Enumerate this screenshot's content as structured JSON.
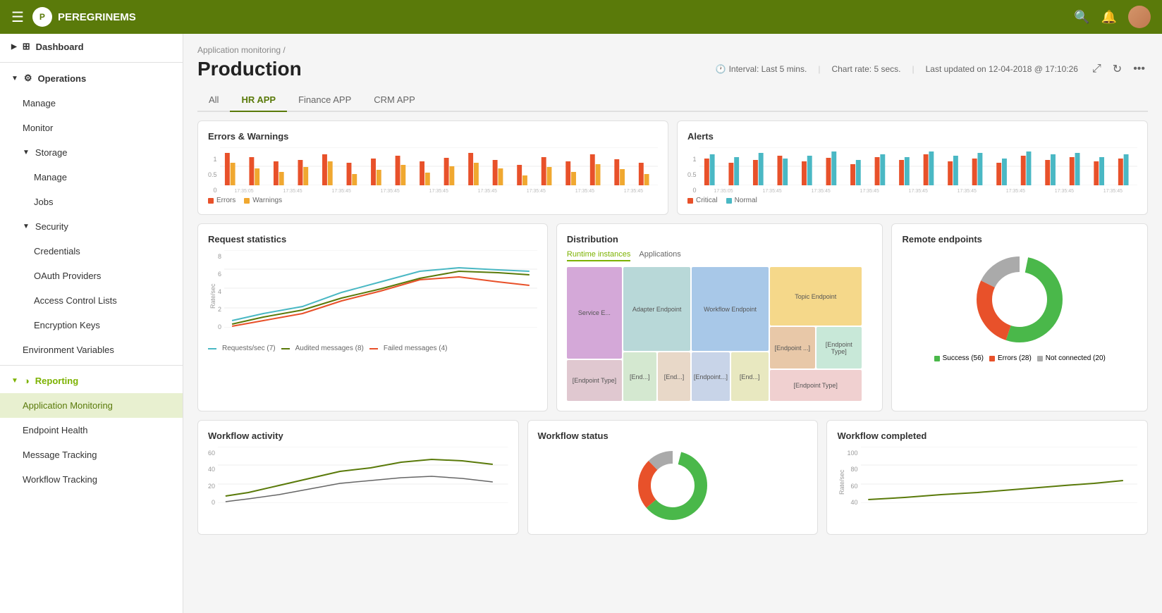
{
  "topnav": {
    "logo_text": "PEREGRINEMS",
    "search_label": "search",
    "bell_label": "notifications",
    "avatar_label": "user avatar"
  },
  "sidebar": {
    "dashboard_label": "Dashboard",
    "operations": {
      "label": "Operations",
      "expanded": true,
      "children": [
        {
          "label": "Manage",
          "level": 1
        },
        {
          "label": "Monitor",
          "level": 1
        },
        {
          "label": "Storage",
          "expanded": true,
          "children": [
            {
              "label": "Manage",
              "level": 2
            },
            {
              "label": "Jobs",
              "level": 2
            }
          ]
        },
        {
          "label": "Security",
          "expanded": true,
          "children": [
            {
              "label": "Credentials",
              "level": 2
            },
            {
              "label": "OAuth Providers",
              "level": 2
            },
            {
              "label": "Access Control Lists",
              "level": 2
            },
            {
              "label": "Encryption Keys",
              "level": 2
            }
          ]
        },
        {
          "label": "Environment Variables",
          "level": 1
        }
      ]
    },
    "reporting": {
      "label": "Reporting",
      "expanded": true,
      "active": true,
      "children": [
        {
          "label": "Application Monitoring",
          "active": true
        },
        {
          "label": "Endpoint Health"
        },
        {
          "label": "Message Tracking"
        },
        {
          "label": "Workflow Tracking"
        }
      ]
    }
  },
  "page": {
    "breadcrumb": "Application monitoring /",
    "title": "Production",
    "interval": "Interval: Last 5 mins.",
    "chart_rate": "Chart rate: 5 secs.",
    "last_updated": "Last updated on 12-04-2018 @ 17:10:26"
  },
  "tabs": {
    "items": [
      "All",
      "HR APP",
      "Finance APP",
      "CRM APP"
    ],
    "active": "HR APP"
  },
  "errors_warnings": {
    "title": "Errors & Warnings",
    "legend": [
      "Errors",
      "Warnings"
    ],
    "colors": [
      "#e8512a",
      "#f0a830"
    ],
    "y_labels": [
      "1",
      "0.5",
      "0"
    ]
  },
  "alerts": {
    "title": "Alerts",
    "legend": [
      "Critical",
      "Normal"
    ],
    "colors": [
      "#e8512a",
      "#4ab8c4"
    ],
    "y_labels": [
      "1",
      "0.5",
      "0"
    ]
  },
  "request_statistics": {
    "title": "Request statistics",
    "y_labels": [
      "8",
      "6",
      "4",
      "2",
      "0"
    ],
    "y_axis_label": "Rate/sec",
    "legend": [
      {
        "label": "Requests/sec (7)",
        "color": "#4ab8c4"
      },
      {
        "label": "Audited messages (8)",
        "color": "#5a7a0a"
      },
      {
        "label": "Failed messages (4)",
        "color": "#e8512a"
      }
    ]
  },
  "distribution": {
    "title": "Distribution",
    "tabs": [
      "Runtime instances",
      "Applications"
    ],
    "active_tab": "Runtime instances",
    "cells": [
      {
        "label": "Service E...",
        "color": "#d4a8d8",
        "col": 0,
        "size": "large"
      },
      {
        "label": "Adapter Endpoint",
        "color": "#b8d8d8",
        "col": 1,
        "size": "large"
      },
      {
        "label": "Workflow Endpoint",
        "color": "#a8c8e8",
        "col": 2,
        "size": "large"
      },
      {
        "label": "Topic Endpoint",
        "color": "#f5d88a",
        "col": 3,
        "size": "large"
      },
      {
        "label": "[Endpoint Type]",
        "color": "#e8c8a8",
        "col": 3,
        "size": "small"
      },
      {
        "label": "[Endpoint Type]",
        "color": "#c8e8d8",
        "col": 3,
        "size": "small2"
      },
      {
        "label": "[Endpoint Type]",
        "color": "#f0d0d0",
        "col": 3,
        "size": "small3"
      },
      {
        "label": "[Endpoint Type]",
        "color": "#d0d8e8",
        "col": 2,
        "size": "small"
      },
      {
        "label": "[Endpoint Type]",
        "color": "#e8d8c8",
        "col": 1,
        "size": "small"
      },
      {
        "label": "[Endpoint...]",
        "color": "#c8d4e8",
        "col": 2,
        "size": "small2"
      },
      {
        "label": "[End...]",
        "color": "#d4e8d0",
        "col": 1,
        "size": "small2"
      },
      {
        "label": "[End...]",
        "color": "#e8e8c0",
        "col": 2,
        "size": "small3"
      },
      {
        "label": "[Endpoint Type]",
        "color": "#e0c8d0",
        "col": 0,
        "size": "bottom"
      }
    ]
  },
  "remote_endpoints": {
    "title": "Remote endpoints",
    "legend": [
      {
        "label": "Success (56)",
        "color": "#4ab84a"
      },
      {
        "label": "Errors (28)",
        "color": "#e8512a"
      },
      {
        "label": "Not connected (20)",
        "color": "#aaaaaa"
      }
    ],
    "values": [
      56,
      28,
      20
    ]
  },
  "workflow_activity": {
    "title": "Workflow activity",
    "y_labels": [
      "60",
      "40",
      "20",
      "0"
    ]
  },
  "workflow_status": {
    "title": "Workflow status"
  },
  "workflow_completed": {
    "title": "Workflow completed",
    "y_labels": [
      "100",
      "80",
      "60",
      "40"
    ],
    "y_axis_label": "Rate/sec"
  }
}
